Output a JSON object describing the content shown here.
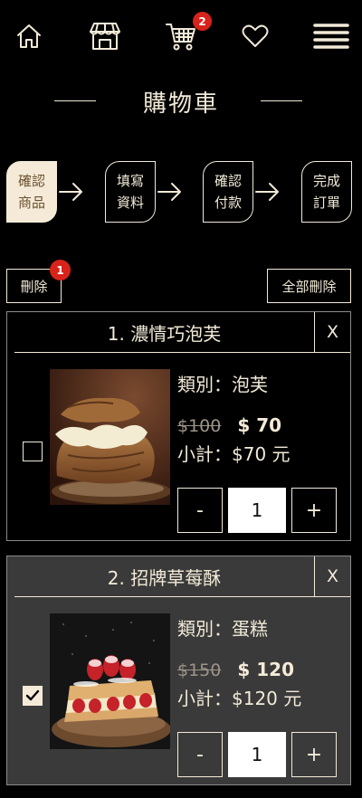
{
  "nav": {
    "icons": [
      "home-icon",
      "store-icon",
      "cart-icon",
      "heart-icon",
      "menu-icon"
    ],
    "cart_count": "2"
  },
  "page": {
    "title": "購物車"
  },
  "steps": [
    {
      "line1": "確認",
      "line2": "商品",
      "active": true
    },
    {
      "line1": "填寫",
      "line2": "資料",
      "active": false
    },
    {
      "line1": "確認",
      "line2": "付款",
      "active": false
    },
    {
      "line1": "完成",
      "line2": "訂單",
      "active": false
    }
  ],
  "actions": {
    "delete_label": "刪除",
    "delete_count": "1",
    "delete_all_label": "全部刪除"
  },
  "items": [
    {
      "title": "1. 濃情巧泡芙",
      "close_label": "X",
      "category": "類別：泡芙",
      "old_price": "$100",
      "price": "$ 70",
      "subtotal": "小計：$70 元",
      "qty": "1",
      "minus": "-",
      "plus": "+",
      "checked": false
    },
    {
      "title": "2. 招牌草莓酥",
      "close_label": "X",
      "category": "類別：蛋糕",
      "old_price": "$150",
      "price": "$ 120",
      "subtotal": "小計：$120 元",
      "qty": "1",
      "minus": "-",
      "plus": "+",
      "checked": true
    }
  ],
  "colors": {
    "background": "#000000",
    "accent": "#f4ead7",
    "badge": "#d8231b",
    "card2_bg": "#3a3a3a"
  }
}
